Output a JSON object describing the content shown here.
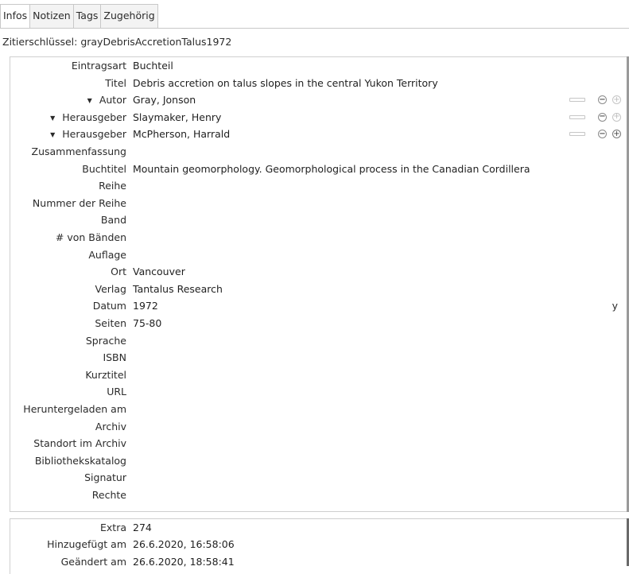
{
  "tabs": [
    "Infos",
    "Notizen",
    "Tags",
    "Zugehörig"
  ],
  "citation_key": "Zitierschlüssel: grayDebrisAccretionTalus1972",
  "fields": [
    {
      "label": "Eintragsart",
      "value": "Buchteil"
    },
    {
      "label": "Titel",
      "value": "Debris accretion on talus slopes in the central Yukon Territory"
    },
    {
      "label": "Autor",
      "value": "Gray, Jonson",
      "creator": true
    },
    {
      "label": "Herausgeber",
      "value": "Slaymaker, Henry",
      "creator": true
    },
    {
      "label": "Herausgeber",
      "value": "McPherson, Harrald",
      "creator": true
    },
    {
      "label": "Zusammenfassung",
      "value": ""
    },
    {
      "label": "Buchtitel",
      "value": "Mountain geomorphology. Geomorphological process in the Canadian Cordillera"
    },
    {
      "label": "Reihe",
      "value": ""
    },
    {
      "label": "Nummer der Reihe",
      "value": ""
    },
    {
      "label": "Band",
      "value": ""
    },
    {
      "label": "# von Bänden",
      "value": ""
    },
    {
      "label": "Auflage",
      "value": ""
    },
    {
      "label": "Ort",
      "value": "Vancouver"
    },
    {
      "label": "Verlag",
      "value": "Tantalus Research"
    },
    {
      "label": "Datum",
      "value": "1972",
      "flag": "y"
    },
    {
      "label": "Seiten",
      "value": "75-80"
    },
    {
      "label": "Sprache",
      "value": ""
    },
    {
      "label": "ISBN",
      "value": ""
    },
    {
      "label": "Kurztitel",
      "value": ""
    },
    {
      "label": "URL",
      "value": ""
    },
    {
      "label": "Heruntergeladen am",
      "value": ""
    },
    {
      "label": "Archiv",
      "value": ""
    },
    {
      "label": "Standort im Archiv",
      "value": ""
    },
    {
      "label": "Bibliothekskatalog",
      "value": ""
    },
    {
      "label": "Signatur",
      "value": ""
    },
    {
      "label": "Rechte",
      "value": ""
    }
  ],
  "meta_fields": [
    {
      "label": "Extra",
      "value": "274"
    },
    {
      "label": "Hinzugefügt am",
      "value": "26.6.2020, 16:58:06"
    },
    {
      "label": "Geändert am",
      "value": "26.6.2020, 18:58:41"
    }
  ],
  "icons": {
    "creator_toggle": "triangle-down-icon",
    "remove": "minus-circle-icon",
    "add": "plus-circle-icon",
    "mode": "name-mode-bar-icon"
  }
}
